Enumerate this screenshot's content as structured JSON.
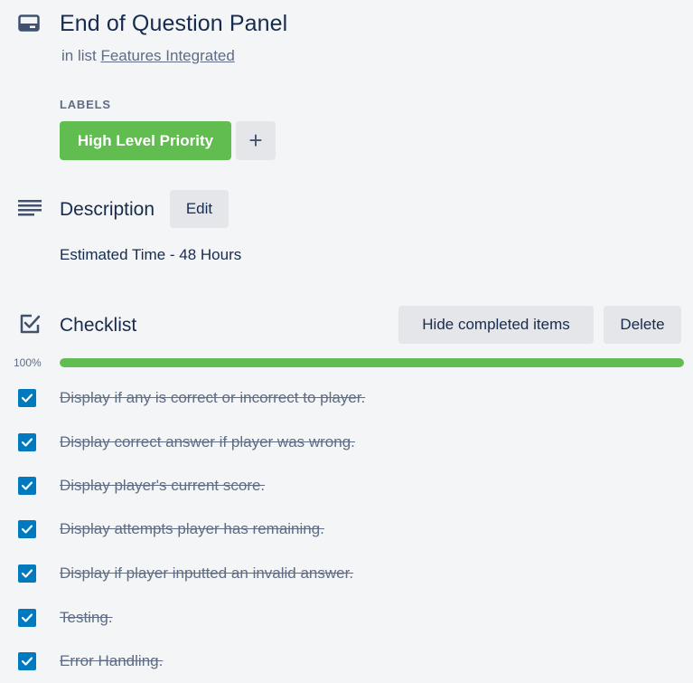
{
  "card": {
    "title": "End of Question Panel",
    "list_prefix": "in list",
    "list_name": "Features Integrated"
  },
  "labels": {
    "heading": "LABELS",
    "items": [
      {
        "text": "High Level Priority",
        "color": "#61bd4f"
      }
    ],
    "add_symbol": "+"
  },
  "description": {
    "title": "Description",
    "edit_label": "Edit",
    "text": "Estimated Time - 48 Hours"
  },
  "checklist": {
    "title": "Checklist",
    "hide_label": "Hide completed items",
    "delete_label": "Delete",
    "progress_text": "100%",
    "progress": 1.0,
    "items": [
      {
        "text": "Display if any is correct or incorrect to player.",
        "checked": true
      },
      {
        "text": "Display correct answer if player was wrong.",
        "checked": true
      },
      {
        "text": "Display player's current score.",
        "checked": true
      },
      {
        "text": "Display attempts player has remaining.",
        "checked": true
      },
      {
        "text": "Display if player inputted an invalid answer.",
        "checked": true
      },
      {
        "text": "Testing.",
        "checked": true
      },
      {
        "text": "Error Handling.",
        "checked": true
      }
    ]
  },
  "colors": {
    "accent_green": "#61bd4f",
    "checkbox_blue": "#0079bf",
    "muted": "#5e6c84"
  }
}
